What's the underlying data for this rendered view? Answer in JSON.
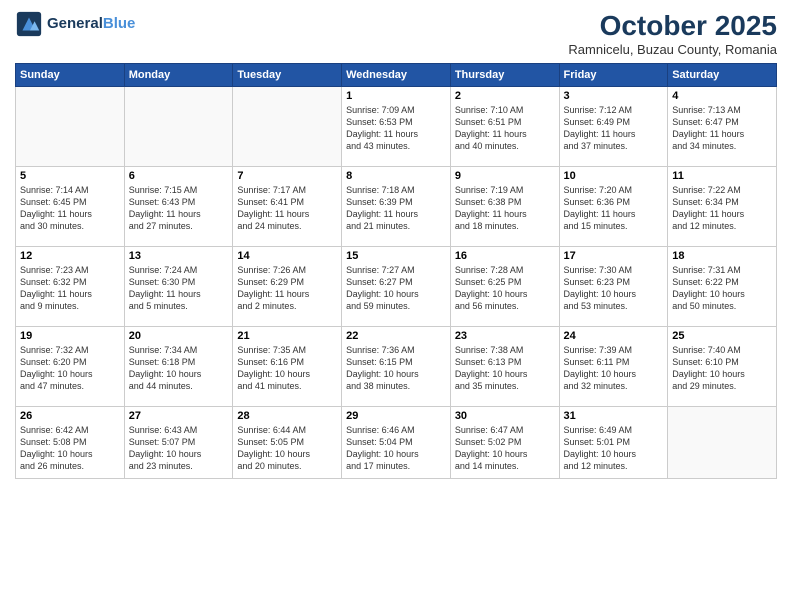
{
  "header": {
    "logo_line1": "General",
    "logo_line2": "Blue",
    "month_title": "October 2025",
    "subtitle": "Ramnicelu, Buzau County, Romania"
  },
  "weekdays": [
    "Sunday",
    "Monday",
    "Tuesday",
    "Wednesday",
    "Thursday",
    "Friday",
    "Saturday"
  ],
  "weeks": [
    [
      {
        "day": "",
        "info": ""
      },
      {
        "day": "",
        "info": ""
      },
      {
        "day": "",
        "info": ""
      },
      {
        "day": "1",
        "info": "Sunrise: 7:09 AM\nSunset: 6:53 PM\nDaylight: 11 hours\nand 43 minutes."
      },
      {
        "day": "2",
        "info": "Sunrise: 7:10 AM\nSunset: 6:51 PM\nDaylight: 11 hours\nand 40 minutes."
      },
      {
        "day": "3",
        "info": "Sunrise: 7:12 AM\nSunset: 6:49 PM\nDaylight: 11 hours\nand 37 minutes."
      },
      {
        "day": "4",
        "info": "Sunrise: 7:13 AM\nSunset: 6:47 PM\nDaylight: 11 hours\nand 34 minutes."
      }
    ],
    [
      {
        "day": "5",
        "info": "Sunrise: 7:14 AM\nSunset: 6:45 PM\nDaylight: 11 hours\nand 30 minutes."
      },
      {
        "day": "6",
        "info": "Sunrise: 7:15 AM\nSunset: 6:43 PM\nDaylight: 11 hours\nand 27 minutes."
      },
      {
        "day": "7",
        "info": "Sunrise: 7:17 AM\nSunset: 6:41 PM\nDaylight: 11 hours\nand 24 minutes."
      },
      {
        "day": "8",
        "info": "Sunrise: 7:18 AM\nSunset: 6:39 PM\nDaylight: 11 hours\nand 21 minutes."
      },
      {
        "day": "9",
        "info": "Sunrise: 7:19 AM\nSunset: 6:38 PM\nDaylight: 11 hours\nand 18 minutes."
      },
      {
        "day": "10",
        "info": "Sunrise: 7:20 AM\nSunset: 6:36 PM\nDaylight: 11 hours\nand 15 minutes."
      },
      {
        "day": "11",
        "info": "Sunrise: 7:22 AM\nSunset: 6:34 PM\nDaylight: 11 hours\nand 12 minutes."
      }
    ],
    [
      {
        "day": "12",
        "info": "Sunrise: 7:23 AM\nSunset: 6:32 PM\nDaylight: 11 hours\nand 9 minutes."
      },
      {
        "day": "13",
        "info": "Sunrise: 7:24 AM\nSunset: 6:30 PM\nDaylight: 11 hours\nand 5 minutes."
      },
      {
        "day": "14",
        "info": "Sunrise: 7:26 AM\nSunset: 6:29 PM\nDaylight: 11 hours\nand 2 minutes."
      },
      {
        "day": "15",
        "info": "Sunrise: 7:27 AM\nSunset: 6:27 PM\nDaylight: 10 hours\nand 59 minutes."
      },
      {
        "day": "16",
        "info": "Sunrise: 7:28 AM\nSunset: 6:25 PM\nDaylight: 10 hours\nand 56 minutes."
      },
      {
        "day": "17",
        "info": "Sunrise: 7:30 AM\nSunset: 6:23 PM\nDaylight: 10 hours\nand 53 minutes."
      },
      {
        "day": "18",
        "info": "Sunrise: 7:31 AM\nSunset: 6:22 PM\nDaylight: 10 hours\nand 50 minutes."
      }
    ],
    [
      {
        "day": "19",
        "info": "Sunrise: 7:32 AM\nSunset: 6:20 PM\nDaylight: 10 hours\nand 47 minutes."
      },
      {
        "day": "20",
        "info": "Sunrise: 7:34 AM\nSunset: 6:18 PM\nDaylight: 10 hours\nand 44 minutes."
      },
      {
        "day": "21",
        "info": "Sunrise: 7:35 AM\nSunset: 6:16 PM\nDaylight: 10 hours\nand 41 minutes."
      },
      {
        "day": "22",
        "info": "Sunrise: 7:36 AM\nSunset: 6:15 PM\nDaylight: 10 hours\nand 38 minutes."
      },
      {
        "day": "23",
        "info": "Sunrise: 7:38 AM\nSunset: 6:13 PM\nDaylight: 10 hours\nand 35 minutes."
      },
      {
        "day": "24",
        "info": "Sunrise: 7:39 AM\nSunset: 6:11 PM\nDaylight: 10 hours\nand 32 minutes."
      },
      {
        "day": "25",
        "info": "Sunrise: 7:40 AM\nSunset: 6:10 PM\nDaylight: 10 hours\nand 29 minutes."
      }
    ],
    [
      {
        "day": "26",
        "info": "Sunrise: 6:42 AM\nSunset: 5:08 PM\nDaylight: 10 hours\nand 26 minutes."
      },
      {
        "day": "27",
        "info": "Sunrise: 6:43 AM\nSunset: 5:07 PM\nDaylight: 10 hours\nand 23 minutes."
      },
      {
        "day": "28",
        "info": "Sunrise: 6:44 AM\nSunset: 5:05 PM\nDaylight: 10 hours\nand 20 minutes."
      },
      {
        "day": "29",
        "info": "Sunrise: 6:46 AM\nSunset: 5:04 PM\nDaylight: 10 hours\nand 17 minutes."
      },
      {
        "day": "30",
        "info": "Sunrise: 6:47 AM\nSunset: 5:02 PM\nDaylight: 10 hours\nand 14 minutes."
      },
      {
        "day": "31",
        "info": "Sunrise: 6:49 AM\nSunset: 5:01 PM\nDaylight: 10 hours\nand 12 minutes."
      },
      {
        "day": "",
        "info": ""
      }
    ]
  ]
}
